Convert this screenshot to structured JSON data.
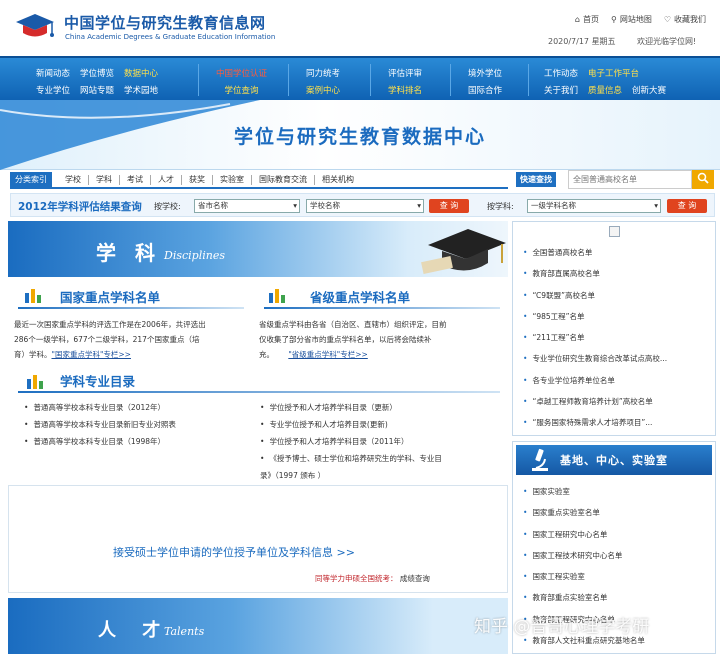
{
  "header": {
    "logo_cn": "中国学位与研究生教育信息网",
    "logo_en": "China Academic Degrees & Graduate Education Information",
    "links": [
      "首页",
      "网站地图",
      "收藏我们"
    ],
    "date": "2020/7/17 星期五",
    "welcome": "欢迎光临学位网!"
  },
  "nav": {
    "col1": [
      "新闻动态",
      "学位博览",
      "数据中心",
      "专业学位",
      "网站专题",
      "学术园地"
    ],
    "col2": [
      "中国学位认证",
      "学位查询"
    ],
    "col3": [
      "同力统考",
      "案例中心"
    ],
    "col4": [
      "评估评审",
      "学科排名"
    ],
    "col5": [
      "境外学位",
      "国际合作"
    ],
    "col6": [
      "工作动态",
      "电子工作平台",
      "关于我们",
      "质量信息",
      "创新大赛"
    ]
  },
  "banner": {
    "title": "学位与研究生教育数据中心"
  },
  "category_bar": {
    "active": "分类索引",
    "items": [
      "学校",
      "学科",
      "考试",
      "人才",
      "获奖",
      "实验室",
      "国际教育交流",
      "相关机构"
    ]
  },
  "quick_search": {
    "label": "快速查找",
    "placeholder": "全国普通高校名单"
  },
  "query": {
    "title": "2012年学科评估结果查询",
    "by_school": "按学校:",
    "province_select": "省市名称",
    "school_select": "学校名称",
    "btn1": "查 询",
    "by_subject": "按学科:",
    "subject_select": "一级学科名称",
    "btn2": "查 询"
  },
  "disciplines": {
    "title": "学 科",
    "en": "Disciplines",
    "national_head": "国家重点学科名单",
    "national_text_1": "最近一次国家重点学科的评选工作是在2006年，共评选出",
    "national_text_2": "286个一级学科，677个二级学科，217个国家重点（培",
    "national_text_3": "育）学科。",
    "national_link": "\"国家重点学科\"专栏>>",
    "provincial_head": "省级重点学科名单",
    "provincial_text_1": "省级重点学科由各省（自治区、直辖市）组织评定，目前",
    "provincial_text_2": "仅收集了部分省市的重点学科名单，以后将会陆续补",
    "provincial_text_3": "充。",
    "provincial_link": "\"省级重点学科\"专栏>>",
    "catalog_head": "学科专业目录",
    "catalog_left": [
      "普通高等学校本科专业目录（2012年）",
      "普通高等学校本科专业目录新旧专业对照表",
      "普通高等学校本科专业目录（1998年）"
    ],
    "catalog_right": [
      "学位授予和人才培养学科目录（更新）",
      "专业学位授予和人才培养目录(更新)",
      "学位授予和人才培养学科目录（2011年）",
      "《授予博士、硕士学位和培养研究生的学科、专业目"
    ],
    "catalog_right_cont": "录》（1997 颁布 ）"
  },
  "apply": {
    "text": "接受硕士学位申请的学位授予单位及学科信息 >>",
    "sub_label": "同等学力申硕全国统考：",
    "sub_link": "成绩查询"
  },
  "talent": {
    "title": "人 才",
    "en": "Talents"
  },
  "side_list": [
    "全国普通高校名单",
    "教育部直属高校名单",
    "“C9联盟”高校名单",
    "“985工程”名单",
    "“211工程”名单",
    "专业学位研究生教育综合改革试点高校...",
    "各专业学位培养单位名单",
    "“卓越工程师教育培养计划”高校名单",
    "“服务国家特殊需求人才培养项目”..."
  ],
  "base": {
    "title": "基地、中心、实验室",
    "items": [
      "国家实验室",
      "国家重点实验室名单",
      "国家工程研究中心名单",
      "国家工程技术研究中心名单",
      "国家工程实验室",
      "教育部重点实验室名单",
      "教育部工程研究中心名单",
      "教育部人文社科重点研究基地名单"
    ]
  },
  "watermark": "知乎 @普哥心理学考研",
  "colors": {
    "brand": "#1b6bbf",
    "nav": "#1565b5",
    "search_btn": "#f0a800",
    "query_btn": "#e0441f"
  }
}
